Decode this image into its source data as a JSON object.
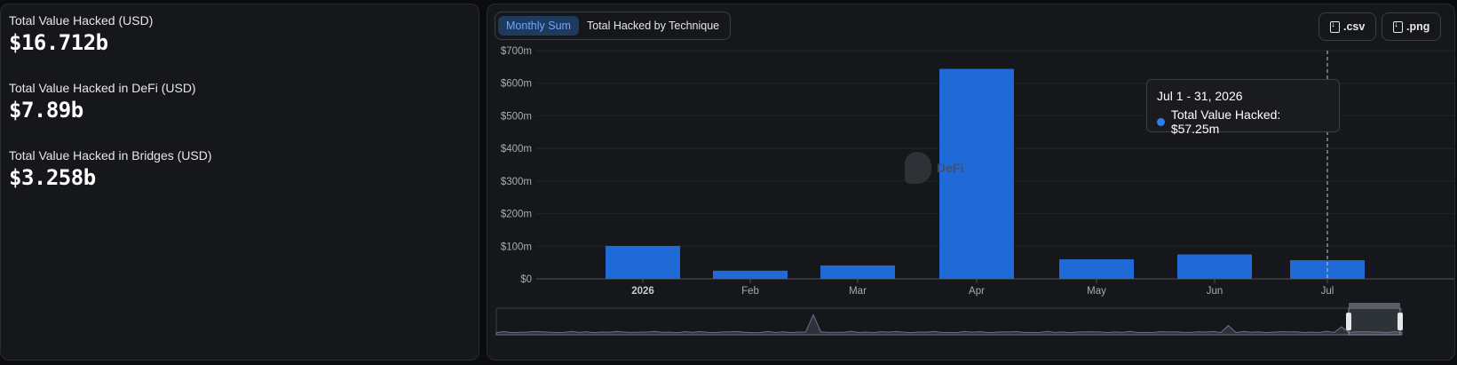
{
  "stats": [
    {
      "label": "Total Value Hacked (USD)",
      "value": "$16.712b"
    },
    {
      "label": "Total Value Hacked in DeFi (USD)",
      "value": "$7.89b"
    },
    {
      "label": "Total Value Hacked in Bridges (USD)",
      "value": "$3.258b"
    }
  ],
  "toggles": {
    "monthly_sum": "Monthly Sum",
    "by_technique": "Total Hacked by Technique"
  },
  "exports": {
    "csv": ".csv",
    "png": ".png"
  },
  "watermark": "DeFi",
  "tooltip": {
    "title": "Jul 1 - 31, 2026",
    "series_label": "Total Value Hacked: $57.25m"
  },
  "colors": {
    "bar": "#1f6ad6",
    "accent": "#6ea7ff",
    "background": "#16171a"
  },
  "chart_data": {
    "type": "bar",
    "categories": [
      "2026",
      "Feb",
      "Mar",
      "Apr",
      "May",
      "Jun",
      "Jul"
    ],
    "bold_categories": [
      "2026"
    ],
    "series": [
      {
        "name": "Total Value Hacked",
        "values": [
          101,
          25,
          41,
          644,
          60,
          75,
          57.25
        ]
      }
    ],
    "y_ticks": [
      "$0",
      "$100m",
      "$200m",
      "$300m",
      "$400m",
      "$500m",
      "$600m",
      "$700m"
    ],
    "ylim": [
      0,
      700
    ],
    "grid": true,
    "crosshair_category": "Jul",
    "brush_overview": true
  }
}
